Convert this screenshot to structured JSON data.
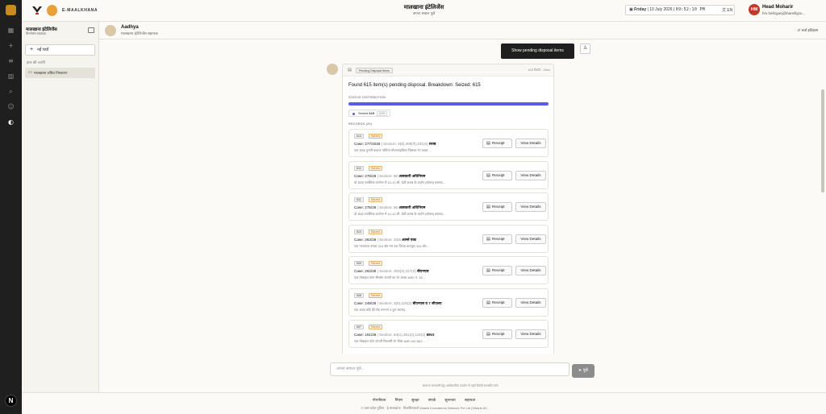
{
  "app": {
    "brand_name": "E-MAALKHANA",
    "header_title": "मालखाना इंटेलिजेंस",
    "header_subtitle": "अपना सवाल पूछें",
    "date_day": "Friday",
    "date": "10 July 2026",
    "time": "09:52:10 PM",
    "lang": "EN"
  },
  "user": {
    "initials": "HM",
    "name": "Head Moharir",
    "email": "hm.hafizganj@bareillypo..."
  },
  "sidebar": {
    "title": "मालखाना इंटेलिजेंस",
    "subtitle": "विश्लेषण सहायक",
    "new_chat": "नई चर्चा",
    "section": "हाल की चर्चाएँ",
    "items": [
      {
        "label": "मालखाना लंबित निस्तारण"
      }
    ]
  },
  "chat_header": {
    "name": "Aadhya",
    "role": "मालखाना इंटेलिजेंस सहायक",
    "history": "चर्चा इतिहास"
  },
  "user_message": "Show pending disposal items",
  "result": {
    "tag": "Pending Disposal Items",
    "meta": "615 रिकॉर्ड  · 13ms",
    "summary": "Found 615 item(s) pending disposal. Breakdown: Seized: 615",
    "status_label": "STATUS DISTRIBUTION",
    "distribution": [
      {
        "name": "Seized",
        "count": "615",
        "pct": "100%",
        "fraction": 1.0,
        "color": "#5b5be0"
      }
    ],
    "records_label": "RECORDS (20)",
    "records": [
      {
        "num": "613",
        "status": "Seized",
        "case": "Case: 277/2026",
        "section": " | Section: 3(5),305(ए),331(4) ",
        "item": "शराब",
        "desc": "एक अदद पुरानी बजाज प्लेटिना मोटरसाइकिल जिसका रंग काला..."
      },
      {
        "num": "612",
        "status": "Seized",
        "case": "Case: 276/26",
        "section": " | Section: 60 ",
        "item": "आबकारी अधिनियम",
        "desc": "दो अदद प्लास्टिक कन्टेनर में 10-10 ली. देशी शराब के कार्टन (बोतल) बरामद..."
      },
      {
        "num": "611",
        "status": "Seized",
        "case": "Case: 275/26",
        "section": " | Section: 60 ",
        "item": "आबकारी अधिनियम",
        "desc": "दो अदद प्लास्टिक कन्टेनर में 10-10 ली. देशी शराब के कार्टन (बोतल) बरामद..."
      },
      {
        "num": "610",
        "status": "Seized",
        "case": "Case: 263/26",
        "section": " | Section: 3/25 ",
        "item": "आर्म्स एक्ट",
        "desc": "एक नाजायज तमंचा 315 बोर मय एक जिन्दा कारतूस 315 बोर..."
      },
      {
        "num": "609",
        "status": "Seized",
        "case": "Case: 262/26",
        "section": " | Section: 303(2),317(2) ",
        "item": "बीएनएस",
        "desc": "एक मोबाइल फोन सैमसंग कंपनी का रंग काला IMEI नं. 35..."
      },
      {
        "num": "608",
        "status": "Seized",
        "case": "Case: 248/26",
        "section": " | Section: 3(5),115(2) ",
        "item": "बीएनएस व 7 सीएलए",
        "desc": "एक अदद लोहे की रॉड लगभग 3 फुट बरामद..."
      },
      {
        "num": "607",
        "status": "Seized",
        "case": "Case: 151/26",
        "section": " | Section: 64(1),351(2),115(2) ",
        "item": "BNS",
        "desc": "एक मोबाइल फोन कंपनी रियलमी रंग नीला IMEI NO 862..."
      }
    ],
    "receipt_label": "Receipt",
    "details_label": "View Details"
  },
  "input": {
    "placeholder": "अपना सवाल पूछें...",
    "send_label": "पूछें"
  },
  "disclaimer": "सामान्य जानकारी हेतु। आधिकारिक उपयोग से पहले रिकॉर्ड सत्यापित करें।",
  "footer": {
    "links": [
      "गोपनीयता",
      "नियम",
      "सुरक्षा",
      "संपर्क",
      "सुलभता",
      "सहायता"
    ],
    "copyright": "© उत्तर प्रदेश पुलिस · ई-मालखाना · विकसितकर्ता Vidaris Innovations Network Pvt Ltd (Vidaris AI)"
  }
}
